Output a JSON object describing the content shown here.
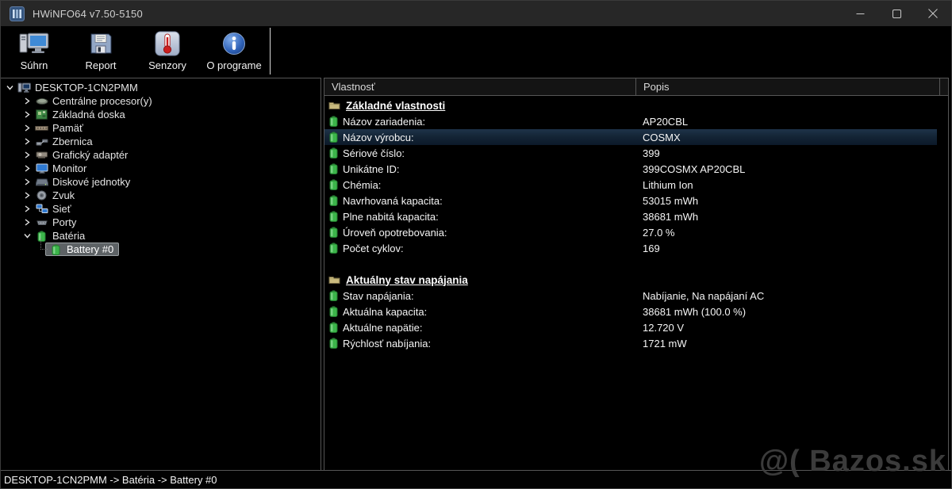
{
  "window": {
    "title": "HWiNFO64 v7.50-5150"
  },
  "toolbar": {
    "items": [
      {
        "label": "Súhrn",
        "icon": "computer-summary-icon"
      },
      {
        "label": "Report",
        "icon": "floppy-report-icon"
      },
      {
        "label": "Senzory",
        "icon": "thermometer-sensors-icon"
      },
      {
        "label": "O programe",
        "icon": "info-about-icon"
      }
    ]
  },
  "tree": {
    "items": [
      {
        "label": "DESKTOP-1CN2PMM",
        "level": 0,
        "expanded": true,
        "icon": "computer-icon"
      },
      {
        "label": "Centrálne procesor(y)",
        "level": 1,
        "expanded": false,
        "icon": "cpu-icon"
      },
      {
        "label": "Základná doska",
        "level": 1,
        "expanded": false,
        "icon": "motherboard-icon"
      },
      {
        "label": "Pamäť",
        "level": 1,
        "expanded": false,
        "icon": "memory-icon"
      },
      {
        "label": "Zbernica",
        "level": 1,
        "expanded": false,
        "icon": "bus-icon"
      },
      {
        "label": "Grafický adaptér",
        "level": 1,
        "expanded": false,
        "icon": "gpu-icon"
      },
      {
        "label": "Monitor",
        "level": 1,
        "expanded": false,
        "icon": "monitor-icon"
      },
      {
        "label": "Diskové jednotky",
        "level": 1,
        "expanded": false,
        "icon": "disk-icon"
      },
      {
        "label": "Zvuk",
        "level": 1,
        "expanded": false,
        "icon": "sound-icon"
      },
      {
        "label": "Sieť",
        "level": 1,
        "expanded": false,
        "icon": "network-icon"
      },
      {
        "label": "Porty",
        "level": 1,
        "expanded": false,
        "icon": "ports-icon"
      },
      {
        "label": "Batéria",
        "level": 1,
        "expanded": true,
        "icon": "battery-icon"
      },
      {
        "label": "Battery #0",
        "level": 2,
        "selected": true,
        "icon": "battery-icon"
      }
    ]
  },
  "properties": {
    "columns": {
      "property": "Vlastnosť",
      "description": "Popis"
    },
    "sections": [
      {
        "title": "Základné vlastnosti",
        "rows": [
          {
            "label": "Názov zariadenia:",
            "value": "AP20CBL"
          },
          {
            "label": "Názov výrobcu:",
            "value": "COSMX",
            "selected": true
          },
          {
            "label": "Sériové číslo:",
            "value": "399"
          },
          {
            "label": "Unikátne ID:",
            "value": "399COSMX AP20CBL"
          },
          {
            "label": "Chémia:",
            "value": "Lithium Ion"
          },
          {
            "label": "Navrhovaná kapacita:",
            "value": "53015 mWh"
          },
          {
            "label": "Plne nabitá kapacita:",
            "value": "38681 mWh"
          },
          {
            "label": "Úroveň opotrebovania:",
            "value": "27.0 %"
          },
          {
            "label": "Počet cyklov:",
            "value": "169"
          }
        ]
      },
      {
        "title": "Aktuálny stav napájania",
        "rows": [
          {
            "label": "Stav napájania:",
            "value": "Nabíjanie, Na napájaní AC"
          },
          {
            "label": "Aktuálna kapacita:",
            "value": "38681 mWh (100.0 %)"
          },
          {
            "label": "Aktuálne napätie:",
            "value": "12.720 V"
          },
          {
            "label": "Rýchlosť nabíjania:",
            "value": "1721 mW"
          }
        ]
      }
    ]
  },
  "statusbar": {
    "path": "DESKTOP-1CN2PMM -> Batéria -> Battery #0"
  },
  "watermark": {
    "text": "@( Bazos.sk"
  },
  "colors": {
    "titlebar_bg": "#272727",
    "panel_border": "#565656",
    "selected_row_bg": "#142536",
    "tree_selection_bg": "#5d6265",
    "battery_green": "#3cb54a",
    "folder_tan": "#c9ba7e",
    "about_blue": "#2f62b8",
    "sensor_red": "#cc1f1f"
  }
}
